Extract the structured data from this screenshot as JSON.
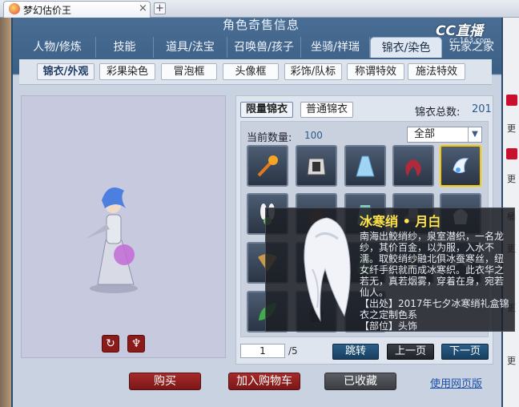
{
  "browser": {
    "tab_title": "梦幻估价王",
    "tab_close": "×",
    "new_tab": "+"
  },
  "header": {
    "title": "角色奇售信息",
    "logo": "CC直播",
    "logo_sub": "cc.163.com"
  },
  "main_tabs": [
    {
      "label": "人物/修炼"
    },
    {
      "label": "技能"
    },
    {
      "label": "道具/法宝"
    },
    {
      "label": "召唤兽/孩子"
    },
    {
      "label": "坐骑/祥瑞"
    },
    {
      "label": "锦衣/染色",
      "active": true
    },
    {
      "label": "玩家之家"
    }
  ],
  "sub_tabs": [
    {
      "label": "锦衣/外观",
      "active": true
    },
    {
      "label": "彩果染色"
    },
    {
      "label": "冒泡框"
    },
    {
      "label": "头像框"
    },
    {
      "label": "彩饰/队标"
    },
    {
      "label": "称谓特效"
    },
    {
      "label": "施法特效"
    }
  ],
  "outfit": {
    "toggle_limited": "限量锦衣",
    "toggle_normal": "普通锦衣",
    "total_label": "锦衣总数:",
    "total_value": "201",
    "current_label": "当前数量:",
    "current_value": "100",
    "filter_value": "全部"
  },
  "side_text": [
    "更",
    "更",
    "桶",
    "更",
    "更",
    "更"
  ],
  "tooltip": {
    "title": "冰寒绡 • 月白",
    "description": "南海出鲛绡纱，泉室潜织，一名龙纱，其价百金，以为服，入水不濡。取鲛绡纱融北俱冰蚕寒丝，纽女纤手织就而成冰寒织。此衣华之若无，真若烟雾，穿着在身，宛若仙人。",
    "source": "【出处】2017年七夕冰寒绡礼盒锦衣之定制色系\n【部位】头饰"
  },
  "pager": {
    "current_page": "1",
    "total_pages": "/5",
    "jump_label": "跳转",
    "prev_label": "上一页",
    "next_label": "下一页"
  },
  "actions": {
    "buy": "购买",
    "add_cart": "加入购物车",
    "favorited": "已收藏",
    "web_version": "使用网页版"
  },
  "colors": {
    "accent_red": "#8b1a1a",
    "title_yellow": "#ffe34a",
    "header_blue": "#3c5f86"
  }
}
